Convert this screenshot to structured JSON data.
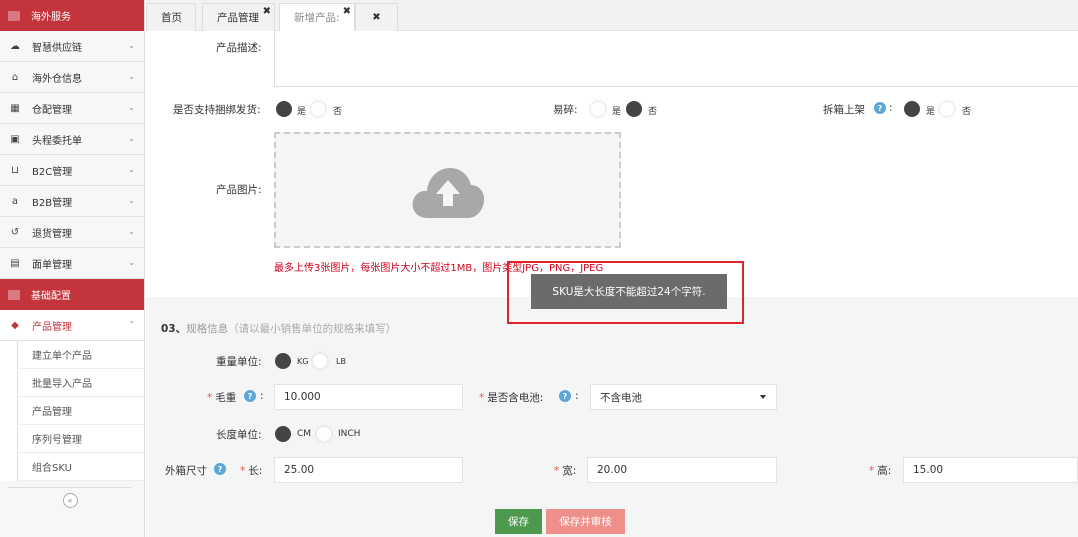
{
  "sidebar": {
    "section_overseas": "海外服务",
    "items_overseas": [
      {
        "label": "智慧供应链",
        "icon": "cloud-icon"
      },
      {
        "label": "海外仓信息",
        "icon": "home-icon"
      },
      {
        "label": "仓配管理",
        "icon": "grid-icon"
      },
      {
        "label": "头程委托单",
        "icon": "briefcase-icon"
      },
      {
        "label": "B2C管理",
        "icon": "cart-icon"
      },
      {
        "label": "B2B管理",
        "icon": "amazon-icon"
      },
      {
        "label": "退货管理",
        "icon": "undo-icon"
      },
      {
        "label": "面单管理",
        "icon": "document-icon"
      }
    ],
    "section_basic": "基础配置",
    "product_mgmt": "产品管理",
    "sub_items": [
      "建立单个产品",
      "批量导入产品",
      "产品管理",
      "序列号管理",
      "组合SKU"
    ],
    "collapse_glyph": "«"
  },
  "tabs": [
    {
      "label": "首页",
      "closable": false
    },
    {
      "label": "产品管理",
      "closable": true
    },
    {
      "label": "新增产品:",
      "closable": true
    },
    {
      "label": "",
      "closable": true
    }
  ],
  "close_glyph": "✖",
  "form": {
    "desc_label": "产品描述:",
    "bundle_label": "是否支持捆绑发货:",
    "fragile_label": "易碎:",
    "unbox_label": "拆箱上架",
    "yes": "是",
    "no": "否",
    "image_label": "产品图片:",
    "image_note": "最多上传3张图片，每张图片大小不超过1MB，图片类型JPG，PNG，JPEG",
    "spec_title_num": "03、",
    "spec_title": "规格信息",
    "spec_hint": "（请以最小销售单位的规格来填写）",
    "weight_unit_label": "重量单位:",
    "weight_units": [
      "KG",
      "LB"
    ],
    "gross_weight_label": "毛重",
    "gross_weight_value": "10.000",
    "battery_label": "是否含电池:",
    "battery_value": "不含电池",
    "length_unit_label": "长度单位:",
    "length_units": [
      "CM",
      "INCH"
    ],
    "box_size_label": "外箱尺寸",
    "length_label": "长:",
    "length_value": "25.00",
    "width_label": "宽:",
    "width_value": "20.00",
    "height_label": "高:",
    "height_value": "15.00",
    "required_mark": "*",
    "colon": ":",
    "help_glyph": "?"
  },
  "buttons": {
    "save": "保存",
    "save_review": "保存并审核"
  },
  "toast": "SKU是大长度不能超过24个字符.",
  "colors": {
    "brand_red": "#c4343c",
    "save_green": "#4d9a4f",
    "save_review_pink": "#ee8f8a",
    "help_blue": "#5aa7d8"
  }
}
